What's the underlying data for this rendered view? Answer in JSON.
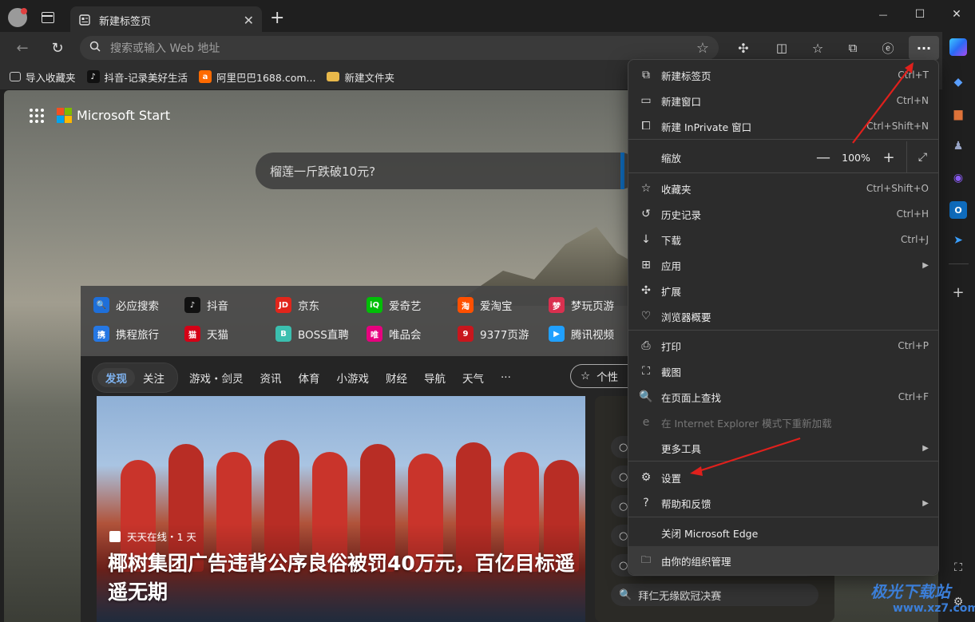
{
  "titlebar": {
    "tab_title": "新建标签页",
    "tab_close": "✕",
    "new_tab": "+",
    "minimize": "—",
    "maximize": "☐",
    "close": "✕"
  },
  "toolbar": {
    "address_placeholder": "搜索或输入 Web 地址",
    "more_button": "···"
  },
  "favorites": [
    {
      "label": "导入收藏夹",
      "icon": "import-icon",
      "color": "#cccccc"
    },
    {
      "label": "抖音-记录美好生活",
      "icon": "douyin-icon",
      "color": "#111111"
    },
    {
      "label": "阿里巴巴1688.com...",
      "icon": "alibaba-icon",
      "color": "#ff6a00"
    },
    {
      "label": "新建文件夹",
      "icon": "folder-icon",
      "color": "#e8b84a"
    }
  ],
  "page": {
    "brand": "Microsoft Start",
    "search_text": "榴莲一斤跌破10元?",
    "quick_links": [
      {
        "label": "必应搜索",
        "color": "#1e6fd9",
        "glyph": "🔍"
      },
      {
        "label": "抖音",
        "color": "#111111",
        "glyph": "♪"
      },
      {
        "label": "京东",
        "color": "#e1251b",
        "glyph": "JD"
      },
      {
        "label": "爱奇艺",
        "color": "#00be06",
        "glyph": "iQ"
      },
      {
        "label": "爱淘宝",
        "color": "#ff5000",
        "glyph": "淘"
      },
      {
        "label": "梦玩页游",
        "color": "#d9304f",
        "glyph": "梦"
      },
      {
        "label": "携程旅行",
        "color": "#2577e3",
        "glyph": "携"
      },
      {
        "label": "天猫",
        "color": "#d40016",
        "glyph": "猫"
      },
      {
        "label": "BOSS直聘",
        "color": "#3bbfaf",
        "glyph": "B"
      },
      {
        "label": "唯品会",
        "color": "#e6007e",
        "glyph": "唯"
      },
      {
        "label": "9377页游",
        "color": "#c8161d",
        "glyph": "9"
      },
      {
        "label": "腾讯视频",
        "color": "#20a0ff",
        "glyph": "▶"
      }
    ],
    "feed_tabs_pill": [
      "发现",
      "关注"
    ],
    "feed_tabs": [
      "游戏・剑灵",
      "资讯",
      "体育",
      "小游戏",
      "财经",
      "导航",
      "天气",
      "···"
    ],
    "customize": "个性",
    "hero_source": "天天在线・1 天",
    "hero_title": "椰树集团广告违背公序良俗被罚40万元，百亿目标遥遥无期",
    "side_item_last": "拜仁无缘欧冠决赛"
  },
  "menu": {
    "items": [
      {
        "label": "新建标签页",
        "shortcut": "Ctrl+T",
        "icon": "new-tab-icon",
        "glyph": "⧉"
      },
      {
        "label": "新建窗口",
        "shortcut": "Ctrl+N",
        "icon": "new-window-icon",
        "glyph": "▭"
      },
      {
        "label": "新建 InPrivate 窗口",
        "shortcut": "Ctrl+Shift+N",
        "icon": "inprivate-icon",
        "glyph": "⧠"
      },
      {
        "label": "缩放",
        "shortcut": "",
        "icon": "",
        "glyph": ""
      },
      {
        "label": "收藏夹",
        "shortcut": "Ctrl+Shift+O",
        "icon": "favorites-icon",
        "glyph": "☆"
      },
      {
        "label": "历史记录",
        "shortcut": "Ctrl+H",
        "icon": "history-icon",
        "glyph": "↺"
      },
      {
        "label": "下载",
        "shortcut": "Ctrl+J",
        "icon": "download-icon",
        "glyph": "↓"
      },
      {
        "label": "应用",
        "shortcut": "",
        "icon": "apps-icon",
        "glyph": "⊞"
      },
      {
        "label": "扩展",
        "shortcut": "",
        "icon": "extensions-icon",
        "glyph": "✣"
      },
      {
        "label": "浏览器概要",
        "shortcut": "",
        "icon": "essentials-icon",
        "glyph": "♡"
      },
      {
        "label": "打印",
        "shortcut": "Ctrl+P",
        "icon": "print-icon",
        "glyph": "⎙"
      },
      {
        "label": "截图",
        "shortcut": "",
        "icon": "screenshot-icon",
        "glyph": "⛶"
      },
      {
        "label": "在页面上查找",
        "shortcut": "Ctrl+F",
        "icon": "find-icon",
        "glyph": "🔍"
      },
      {
        "label": "在 Internet Explorer 模式下重新加载",
        "shortcut": "",
        "icon": "ie-mode-icon",
        "glyph": "e"
      },
      {
        "label": "更多工具",
        "shortcut": "",
        "icon": "",
        "glyph": ""
      },
      {
        "label": "设置",
        "shortcut": "",
        "icon": "settings-icon",
        "glyph": "⚙"
      },
      {
        "label": "帮助和反馈",
        "shortcut": "",
        "icon": "help-icon",
        "glyph": "?"
      },
      {
        "label": "关闭 Microsoft Edge",
        "shortcut": "",
        "icon": "",
        "glyph": ""
      },
      {
        "label": "由你的组织管理",
        "shortcut": "",
        "icon": "managed-icon",
        "glyph": "🗀"
      }
    ],
    "zoom_minus": "—",
    "zoom_value": "100%",
    "zoom_plus": "+",
    "fullscreen": "⤢"
  },
  "watermark": {
    "line1": "极光下载站",
    "line2": "www.xz7.com"
  },
  "colors": {
    "accent": "#0f6cbd",
    "arrow": "#e0201c"
  }
}
